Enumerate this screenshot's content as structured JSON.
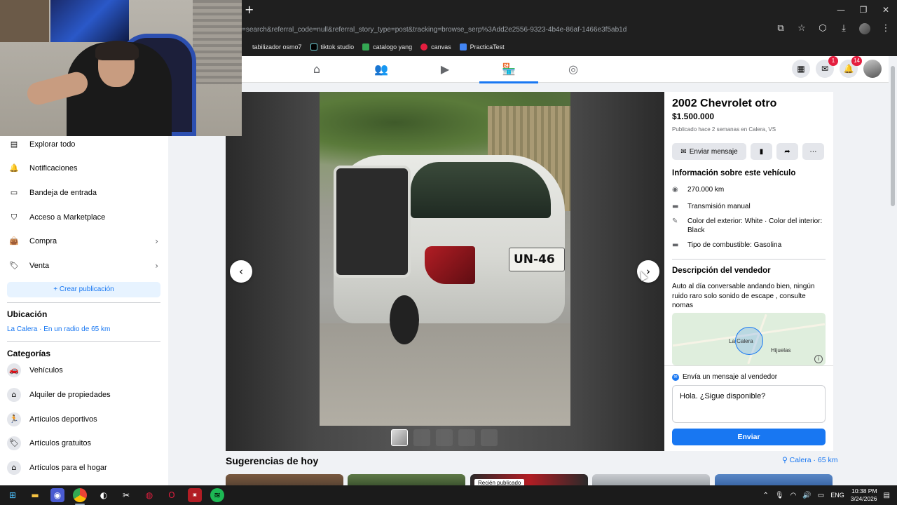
{
  "browser": {
    "new_tab_glyph": "+",
    "url": "=search&referral_code=null&referral_story_type=post&tracking=browse_serp%3Add2e2556-9323-4b4e-86af-1466e3f5ab1d",
    "bookmarks": [
      {
        "label": "tabilizador osmo7",
        "icon_color": "#1f1f1f"
      },
      {
        "label": "tiktok studio",
        "icon_color": "#000000"
      },
      {
        "label": "catalogo yang",
        "icon_color": "#34a853"
      },
      {
        "label": "canvas",
        "icon_color": "#e41e3f"
      },
      {
        "label": "PracticaTest",
        "icon_color": "#4285f4"
      }
    ]
  },
  "header": {
    "messenger_badge": "1",
    "notifications_badge": "14"
  },
  "sidebar": {
    "items": [
      {
        "label": "Explorar todo"
      },
      {
        "label": "Notificaciones"
      },
      {
        "label": "Bandeja de entrada"
      },
      {
        "label": "Acceso a Marketplace"
      },
      {
        "label": "Compra"
      },
      {
        "label": "Venta"
      }
    ],
    "create_label": "+ Crear publicación",
    "location_heading": "Ubicación",
    "location_value": "La Calera · En un radio de 65 km",
    "categories_heading": "Categorías",
    "categories": [
      {
        "label": "Vehículos"
      },
      {
        "label": "Alquiler de propiedades"
      },
      {
        "label": "Artículos deportivos"
      },
      {
        "label": "Artículos gratuitos"
      },
      {
        "label": "Artículos para el hogar"
      }
    ]
  },
  "viewer": {
    "plate_text": "UN-46",
    "prev_glyph": "‹",
    "next_glyph": "›"
  },
  "listing": {
    "title": "2002 Chevrolet otro",
    "price": "$1.500.000",
    "posted": "Publicado hace 2 semanas en Calera, VS",
    "message_button": "Enviar mensaje",
    "info_heading": "Información sobre este vehículo",
    "details": [
      {
        "text": "270.000 km",
        "icon": "speedometer-icon"
      },
      {
        "text": "Transmisión manual",
        "icon": "transmission-icon"
      },
      {
        "text": "Color del exterior: White · Color del interior: Black",
        "icon": "paint-icon"
      },
      {
        "text": "Tipo de combustible: Gasolina",
        "icon": "fuel-icon"
      }
    ],
    "seller_heading": "Descripción del vendedor",
    "seller_description": "Auto al día conversable andando bien, ningún ruido raro solo sonido de escape , consulte nomas",
    "map_labels": {
      "city": "La Calera",
      "nearby": "Hijuelas"
    }
  },
  "message": {
    "heading": "Envía un mensaje al vendedor",
    "value": "Hola. ¿Sigue disponible?",
    "send_label": "Enviar"
  },
  "suggestions": {
    "title": "Sugerencias de hoy",
    "location": "Calera · 65 km",
    "recent_tag": "Recién publicado"
  },
  "taskbar": {
    "lang": "ENG",
    "time": "10:38 PM",
    "date": "3/24/2026"
  }
}
